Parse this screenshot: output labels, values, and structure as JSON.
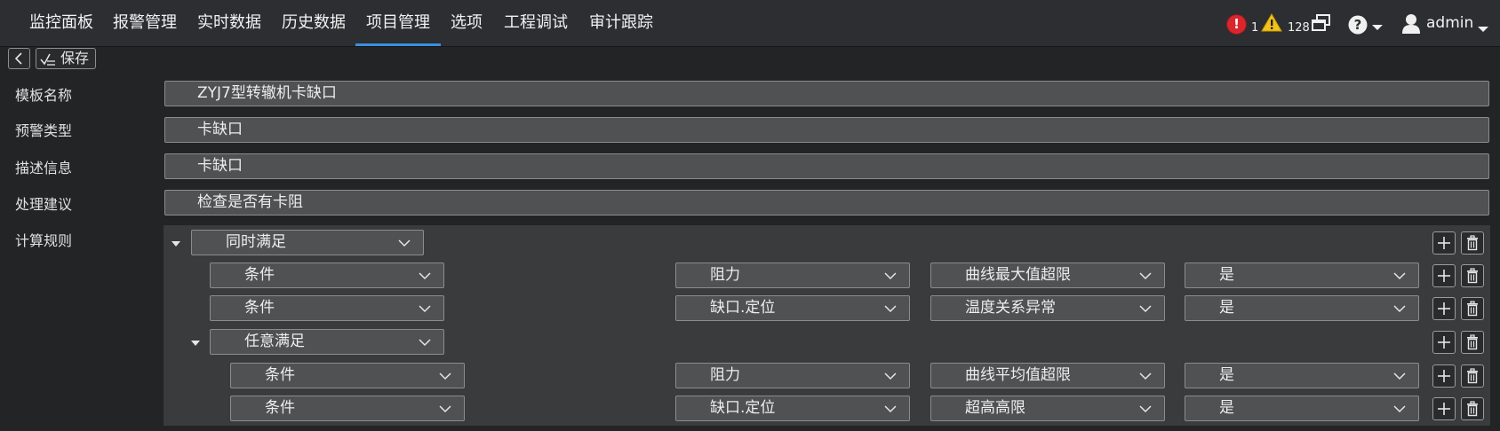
{
  "nav": {
    "items": [
      "监控面板",
      "报警管理",
      "实时数据",
      "历史数据",
      "项目管理",
      "选项",
      "工程调试",
      "审计跟踪"
    ],
    "active_index": 4
  },
  "status": {
    "alarm_count": "1",
    "warning_count": "128",
    "user": "admin"
  },
  "toolbar": {
    "save_label": "保存"
  },
  "form": {
    "template_name": {
      "label": "模板名称",
      "value": "ZYJ7型转辙机卡缺口"
    },
    "warning_type": {
      "label": "预警类型",
      "value": "卡缺口"
    },
    "description": {
      "label": "描述信息",
      "value": "卡缺口"
    },
    "suggestion": {
      "label": "处理建议",
      "value": "检查是否有卡阻"
    },
    "rules_label": "计算规则"
  },
  "rules": {
    "root_group": "同时满足",
    "rows": [
      {
        "type": "条件",
        "signal": "阻力",
        "check": "曲线最大值超限",
        "result": "是"
      },
      {
        "type": "条件",
        "signal": "缺口.定位",
        "check": "温度关系异常",
        "result": "是"
      }
    ],
    "sub_group": "任意满足",
    "sub_rows": [
      {
        "type": "条件",
        "signal": "阻力",
        "check": "曲线平均值超限",
        "result": "是"
      },
      {
        "type": "条件",
        "signal": "缺口.定位",
        "check": "超高高限",
        "result": "是"
      }
    ]
  },
  "icons": {
    "alarm": "alarm-icon",
    "warning": "warning-icon",
    "windows": "windows-icon",
    "help": "help-icon",
    "user": "user-icon",
    "back": "back-icon",
    "save": "save-icon",
    "add": "plus-icon",
    "delete": "trash-icon",
    "expand": "expand-triangle-icon",
    "dropdown": "chevron-down-icon"
  },
  "colors": {
    "accent": "#3b8fde",
    "alarm": "#d9262d",
    "warning": "#f3c21b"
  }
}
